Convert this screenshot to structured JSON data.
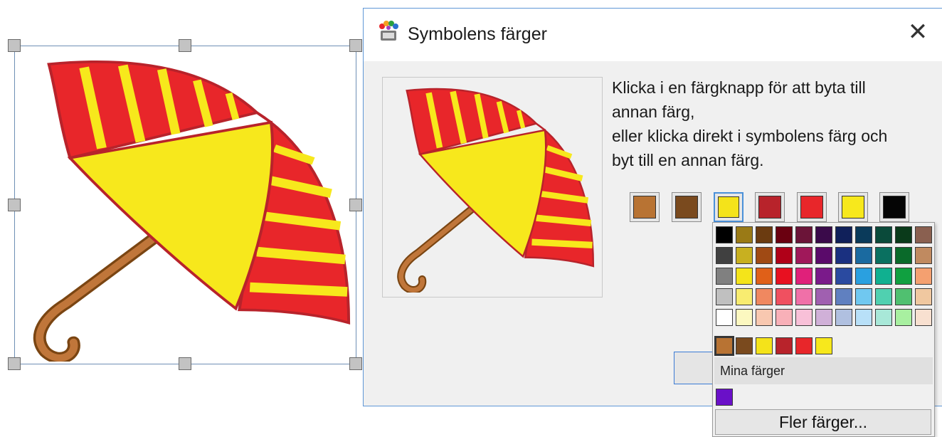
{
  "dialog": {
    "title": "Symbolens färger",
    "instructions": [
      "Klicka i en färgknapp för att byta till",
      "annan färg,",
      "eller klicka direkt i symbolens färg och",
      "byt till en annan färg."
    ],
    "swatches": [
      "#b87333",
      "#7a4a1e",
      "#f4e31a",
      "#b8232b",
      "#e8262a",
      "#f7e81c",
      "#050505"
    ],
    "active_swatch_index": 2
  },
  "palette": {
    "grid": [
      [
        "#000000",
        "#9a7a16",
        "#6b3b10",
        "#6a0010",
        "#6b1438",
        "#3a0a4a",
        "#10205a",
        "#0a3a5a",
        "#0a4a3a",
        "#0a3a1a",
        "#8a6050"
      ],
      [
        "#404040",
        "#c8b020",
        "#a04a14",
        "#b00018",
        "#a0185a",
        "#5a0a6a",
        "#1a3080",
        "#1a6aa0",
        "#0a7060",
        "#0a6a2a",
        "#c08a60"
      ],
      [
        "#808080",
        "#f4e41a",
        "#e06018",
        "#e81020",
        "#e0207a",
        "#7a1a8a",
        "#2a4aa0",
        "#2aa0e0",
        "#10b090",
        "#10a040",
        "#f4a070"
      ],
      [
        "#c0c0c0",
        "#f8ec70",
        "#f08860",
        "#f05060",
        "#f070a8",
        "#a060b0",
        "#6080c0",
        "#70c8f0",
        "#50d0b0",
        "#50c070",
        "#f0c8a0"
      ],
      [
        "#ffffff",
        "#fcf8c0",
        "#f8c8b0",
        "#f8b0b8",
        "#f8c0d8",
        "#d0b0d8",
        "#b0c0e0",
        "#b8e0f8",
        "#a8e8d8",
        "#a8f0a0",
        "#f8e0d0"
      ]
    ],
    "recent": [
      "#b87333",
      "#7a4a1e",
      "#f4e31a",
      "#b8232b",
      "#e8262a",
      "#f7e81c"
    ],
    "my_colors_label": "Mina färger",
    "my_colors": [
      "#6a10c8"
    ],
    "more_colors_label": "Fler färger..."
  }
}
